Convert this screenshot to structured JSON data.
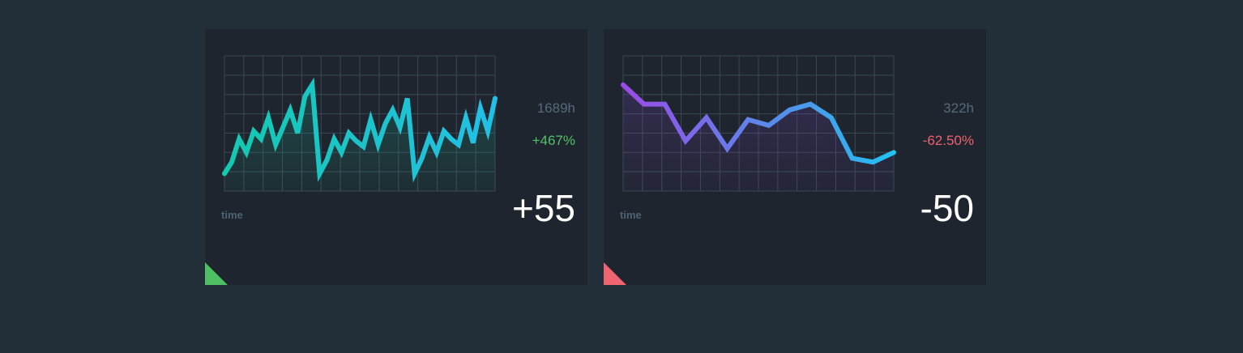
{
  "cards": [
    {
      "hours": "1689h",
      "change": "+467%",
      "change_color": "#52c26a",
      "value": "+55",
      "x_label": "time",
      "corner_color": "#4fc062",
      "gradient": [
        "#14c9b0",
        "#23c0e6"
      ],
      "fill_color": "#14c9a6"
    },
    {
      "hours": "322h",
      "change": "-62.50%",
      "change_color": "#f0616e",
      "value": "-50",
      "x_label": "time",
      "corner_color": "#ef6470",
      "gradient": [
        "#9b4ae6",
        "#22c1ef"
      ],
      "fill_color": "#7a43c9"
    }
  ],
  "chart_data": [
    {
      "type": "area",
      "xlabel": "time",
      "ylabel": "",
      "ylim": [
        0,
        7
      ],
      "x": [
        0,
        0.5,
        1,
        1.5,
        2,
        2.5,
        3,
        3.5,
        4,
        4.5,
        5,
        5.5,
        6,
        6.5,
        7,
        7.5,
        8,
        8.5,
        9,
        9.5,
        10,
        10.5,
        11,
        11.5,
        12,
        12.5,
        13,
        13.5,
        14,
        14
      ],
      "values": [
        0.9,
        1.5,
        2.7,
        2.0,
        3.1,
        2.7,
        3.8,
        2.4,
        3.3,
        4.2,
        3.0,
        4.9,
        5.5,
        0.9,
        1.6,
        2.7,
        2.0,
        3.0,
        2.6,
        2.3,
        3.7,
        2.4,
        3.5,
        4.2,
        3.3,
        4.8,
        0.9,
        1.7,
        2.8,
        2.0,
        3.1,
        2.7,
        2.4,
        3.8,
        2.5,
        4.3,
        3.1,
        4.8
      ]
    },
    {
      "type": "area",
      "xlabel": "time",
      "ylabel": "",
      "ylim": [
        0,
        7
      ],
      "x": [
        0,
        1,
        2,
        3,
        4,
        5,
        6,
        7,
        8,
        9,
        10,
        11,
        12,
        13
      ],
      "values": [
        5.5,
        4.5,
        4.5,
        2.6,
        3.8,
        2.2,
        3.7,
        3.4,
        4.2,
        4.5,
        3.8,
        1.7,
        1.5,
        2.0
      ]
    }
  ]
}
